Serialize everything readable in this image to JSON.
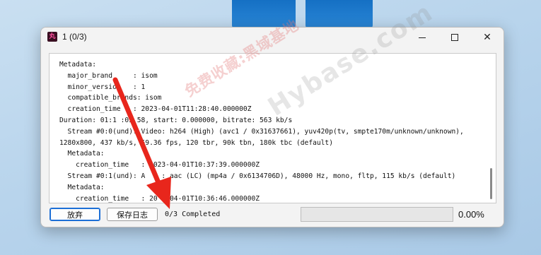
{
  "window": {
    "title": "1 (0/3)",
    "app_icon_glyph": "丸",
    "minimize_glyph": "minimize-icon",
    "maximize_glyph": "maximize-icon",
    "close_glyph": "✕"
  },
  "log": {
    "lines": [
      "Metadata:",
      "  major_brand     : isom",
      "  minor_version   : 1",
      "  compatible_brands: isom",
      "  creation_time   : 2023-04-01T11:28:40.000000Z",
      "Duration: 01:1 :05.58, start: 0.000000, bitrate: 563 kb/s",
      "  Stream #0:0(und): Video: h264 (High) (avc1 / 0x31637661), yuv420p(tv, smpte170m/unknown/unknown),",
      "1280x800, 437 kb/s, 59.36 fps, 120 tbr, 90k tbn, 180k tbc (default)",
      "  Metadata:",
      "    creation_time   : 2023-04-01T10:37:39.000000Z",
      "  Stream #0:1(und): A    : aac (LC) (mp4a / 0x6134706D), 48000 Hz, mono, fltp, 115 kb/s (default)",
      "  Metadata:",
      "    creation_time   : 20  -04-01T10:36:46.000000Z"
    ]
  },
  "footer": {
    "abandon_label": "放弃",
    "save_log_label": "保存日志",
    "status_text": "0/3 Completed",
    "progress_fraction": 0.0,
    "percent_text": "0.00%"
  },
  "watermark": {
    "cn": "免费收藏:黑域基地",
    "en": "Hybase.com"
  },
  "colors": {
    "accent": "#1d6fd6",
    "progress": "#06b025",
    "arrow": "#e8261c"
  }
}
